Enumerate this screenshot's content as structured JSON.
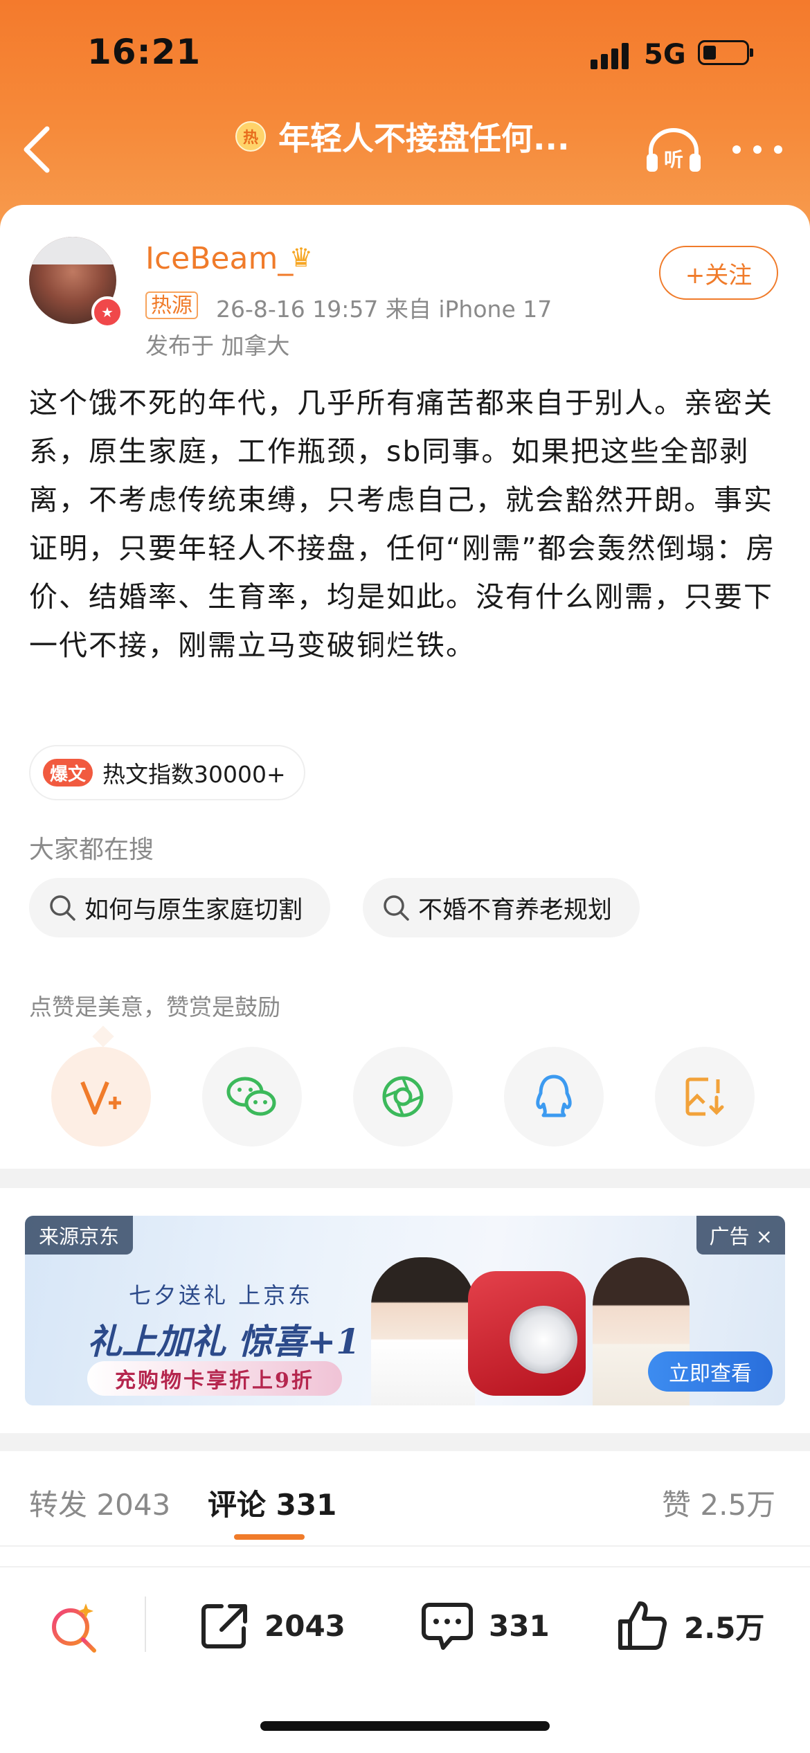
{
  "status_bar": {
    "time": "16:21",
    "network": "5G"
  },
  "nav": {
    "hot_badge": "热",
    "title": "年轻人不接盘任何..."
  },
  "post": {
    "username": "IceBeam_",
    "source_tag": "热源",
    "meta": "26-8-16 19:57  来自 iPhone 17",
    "location": "发布于 加拿大",
    "follow_label": "+关注",
    "body": "这个饿不死的年代，几乎所有痛苦都来自于别人。亲密关系，原生家庭，工作瓶颈，sb同事。如果把这些全部剥离，不考虑传统束缚，只考虑自己，就会豁然开朗。事实证明，只要年轻人不接盘，任何“刚需”都会轰然倒塌：房价、结婚率、生育率，均是如此。没有什么刚需，只要下一代不接，刚需立马变破铜烂铁。",
    "hot_badge": "爆文",
    "hot_index": "热文指数30000+"
  },
  "search": {
    "title": "大家都在搜",
    "items": [
      "如何与原生家庭切割",
      "不婚不育养老规划"
    ]
  },
  "reward": {
    "text": "点赞是美意，赞赏是鼓励"
  },
  "share_icons": [
    "v-plus-icon",
    "wechat-icon",
    "moments-icon",
    "qq-icon",
    "save-image-icon"
  ],
  "ad": {
    "source": "来源京东",
    "tag": "广告 ×",
    "line1": "七夕送礼 上京东",
    "line2": "礼上加礼 惊喜+1",
    "line3": "充购物卡享折上9折",
    "cta": "立即查看"
  },
  "tabs": {
    "repost_label": "转发",
    "repost_count": "2043",
    "comment_label": "评论",
    "comment_count": "331",
    "like_label": "赞",
    "like_count": "2.5万"
  },
  "bottom_bar": {
    "repost": "2043",
    "comment": "331",
    "like": "2.5万"
  },
  "colors": {
    "accent": "#f07b2a",
    "header_gradient_top": "#f47a2c",
    "hot_red": "#f15a3f"
  }
}
